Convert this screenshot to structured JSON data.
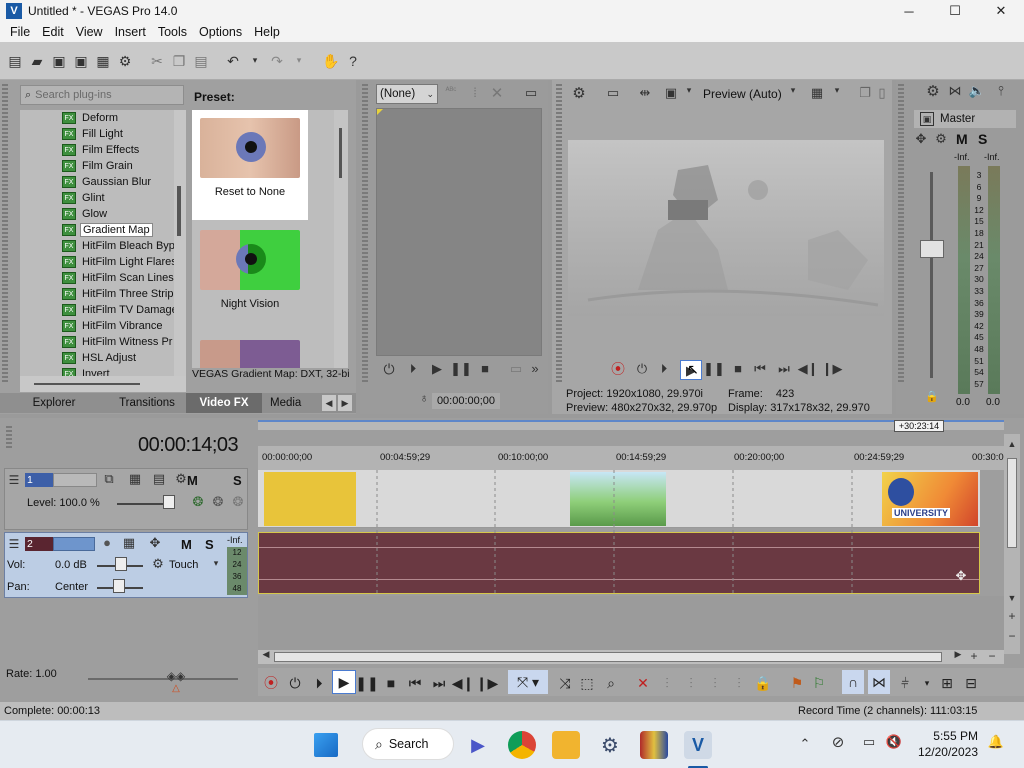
{
  "window": {
    "title": "Untitled * - VEGAS Pro 14.0",
    "minimize": "─",
    "maximize": "☐",
    "close": "✕"
  },
  "menu": [
    "File",
    "Edit",
    "View",
    "Insert",
    "Tools",
    "Options",
    "Help"
  ],
  "plugins": {
    "search_placeholder": "Search plug-ins",
    "items": [
      "Deform",
      "Fill Light",
      "Film Effects",
      "Film Grain",
      "Gaussian Blur",
      "Glint",
      "Glow",
      "Gradient Map",
      "HitFilm Bleach Byp",
      "HitFilm Light Flares",
      "HitFilm Scan Lines",
      "HitFilm Three Strip",
      "HitFilm TV Damage",
      "HitFilm Vibrance",
      "HitFilm Witness Pr",
      "HSL Adjust",
      "Invert"
    ],
    "selected": "Gradient Map",
    "preset_label": "Preset:",
    "presets": [
      "Reset to None",
      "Night Vision",
      ""
    ],
    "description": "VEGAS Gradient Map: DXT, 32-bi",
    "tabs": [
      "Explorer",
      "Transitions",
      "Video FX",
      "Media"
    ],
    "active_tab": "Video FX"
  },
  "trimmer": {
    "select_value": "(None)",
    "time": "00:00:00;00"
  },
  "preview": {
    "mode": "Preview (Auto)",
    "info": {
      "project_label": "Project:",
      "project": "1920x1080, 29.970i",
      "frame_label": "Frame:",
      "frame": "423",
      "preview_label": "Preview:",
      "preview": "480x270x32, 29.970p",
      "display_label": "Display:",
      "display": "317x178x32, 29.970"
    }
  },
  "mixer": {
    "master": "Master",
    "m_label": "M",
    "s_label": "S",
    "inf_left": "-Inf.",
    "inf_right": "-Inf.",
    "scale": [
      "3",
      "6",
      "9",
      "12",
      "15",
      "18",
      "21",
      "24",
      "27",
      "30",
      "33",
      "36",
      "39",
      "42",
      "45",
      "48",
      "51",
      "54",
      "57"
    ],
    "bottom_left": "0.0",
    "bottom_right": "0.0"
  },
  "timeline": {
    "timecode": "00:00:14;03",
    "duration_badge": "+30:23:14",
    "ruler": [
      "00:00:00;00",
      "00:04:59;29",
      "00:10:00;00",
      "00:14:59;29",
      "00:20:00;00",
      "00:24:59;29",
      "00:30:0"
    ],
    "track1": {
      "num": "1",
      "level": "Level: 100.0 %",
      "m": "M",
      "s": "S"
    },
    "track2": {
      "num": "2",
      "vol_label": "Vol:",
      "vol": "0.0 dB",
      "pan_label": "Pan:",
      "pan": "Center",
      "touch": "Touch",
      "m": "M",
      "s": "S",
      "inf": "-Inf.",
      "mini_scale": [
        "12",
        "24",
        "36",
        "48"
      ]
    },
    "clip_text": "UNIVERSITY",
    "rate": "Rate: 1.00"
  },
  "status": {
    "left": "Complete: 00:00:13",
    "right": "Record Time (2 channels): 111:03:15"
  },
  "taskbar": {
    "search": "Search",
    "time": "5:55 PM",
    "date": "12/20/2023"
  },
  "colors": {
    "accent": "#1a5aa5",
    "audio_track": "#6a3942",
    "track2_header": "#bccde4",
    "clip_yellow": "#e8c43a"
  }
}
